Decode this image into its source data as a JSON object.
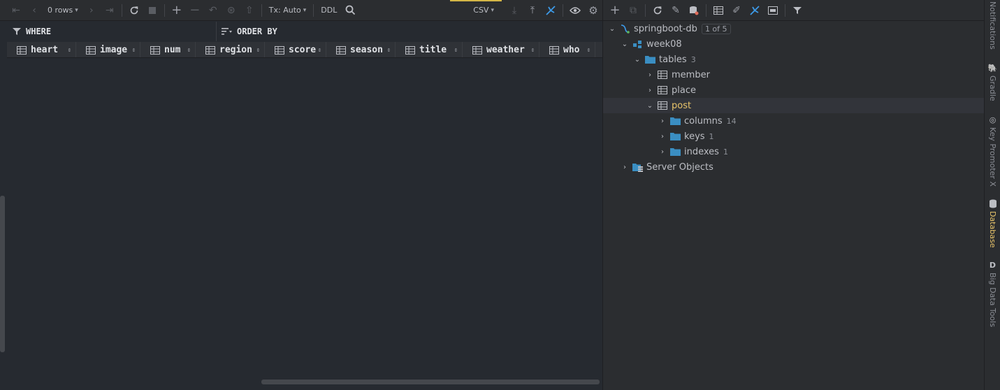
{
  "left_toolbar": {
    "rows_label": "0 rows",
    "tx_label": "Tx: Auto",
    "ddl_label": "DDL",
    "export_format": "CSV"
  },
  "filter": {
    "where_label": "WHERE",
    "orderby_label": "ORDER BY"
  },
  "columns": [
    "heart",
    "image",
    "num",
    "region",
    "score",
    "season",
    "title",
    "weather",
    "who"
  ],
  "tree": {
    "datasource": {
      "label": "springboot-db",
      "badge": "1 of 5"
    },
    "schema": {
      "label": "week08"
    },
    "tables_folder": {
      "label": "tables",
      "count": "3"
    },
    "tables": [
      "member",
      "place",
      "post"
    ],
    "post_children": [
      {
        "label": "columns",
        "count": "14"
      },
      {
        "label": "keys",
        "count": "1"
      },
      {
        "label": "indexes",
        "count": "1"
      }
    ],
    "server_objects": {
      "label": "Server Objects"
    }
  },
  "stripe": {
    "notifications": "Notifications",
    "gradle": "Gradle",
    "key_promoter": "Key Promoter X",
    "database": "Database",
    "big_data_tools": "Big Data Tools"
  },
  "colors": {
    "accent_blue": "#3d9be9",
    "highlight_yellow": "#e8c46a",
    "folder_blue": "#3a8ec2"
  }
}
